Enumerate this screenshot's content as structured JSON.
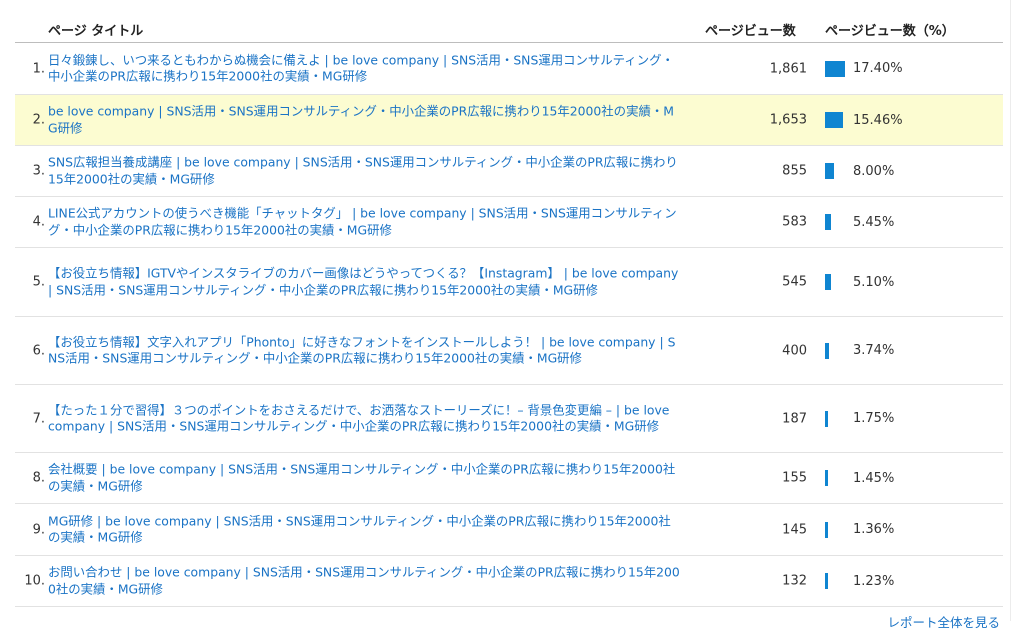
{
  "header": {
    "page_title": "ページ タイトル",
    "pageviews": "ページビュー数",
    "pageviews_pct": "ページビュー数（%）"
  },
  "accent_color": "#0f85d1",
  "highlight_color": "#fcfcd1",
  "rows": [
    {
      "rank": "1.",
      "title": "日々鍛錬し、いつ来るともわからぬ機会に備えよ | be love company | SNS活用・SNS運用コンサルティング・中小企業のPR広報に携わり15年2000社の実績・MG研修",
      "views": "1,861",
      "pct": "17.40%",
      "pct_value": 17.4
    },
    {
      "rank": "2.",
      "title": "be love company | SNS活用・SNS運用コンサルティング・中小企業のPR広報に携わり15年2000社の実績・MG研修",
      "views": "1,653",
      "pct": "15.46%",
      "pct_value": 15.46
    },
    {
      "rank": "3.",
      "title": "SNS広報担当養成講座 | be love company | SNS活用・SNS運用コンサルティング・中小企業のPR広報に携わり15年2000社の実績・MG研修",
      "views": "855",
      "pct": "8.00%",
      "pct_value": 8.0
    },
    {
      "rank": "4.",
      "title": "LINE公式アカウントの使うべき機能「チャットタグ」 | be love company | SNS活用・SNS運用コンサルティング・中小企業のPR広報に携わり15年2000社の実績・MG研修",
      "views": "583",
      "pct": "5.45%",
      "pct_value": 5.45
    },
    {
      "rank": "5.",
      "title": "【お役立ち情報】IGTVやインスタライブのカバー画像はどうやってつくる？【Instagram】 | be love company | SNS活用・SNS運用コンサルティング・中小企業のPR広報に携わり15年2000社の実績・MG研修",
      "views": "545",
      "pct": "5.10%",
      "pct_value": 5.1
    },
    {
      "rank": "6.",
      "title": "【お役立ち情報】文字入れアプリ「Phonto」に好きなフォントをインストールしよう！ | be love company | SNS活用・SNS運用コンサルティング・中小企業のPR広報に携わり15年2000社の実績・MG研修",
      "views": "400",
      "pct": "3.74%",
      "pct_value": 3.74
    },
    {
      "rank": "7.",
      "title": "【たった１分で習得】３つのポイントをおさえるだけで、お洒落なストーリーズに！– 背景色変更編 – | be love company | SNS活用・SNS運用コンサルティング・中小企業のPR広報に携わり15年2000社の実績・MG研修",
      "views": "187",
      "pct": "1.75%",
      "pct_value": 1.75
    },
    {
      "rank": "8.",
      "title": "会社概要 | be love company | SNS活用・SNS運用コンサルティング・中小企業のPR広報に携わり15年2000社の実績・MG研修",
      "views": "155",
      "pct": "1.45%",
      "pct_value": 1.45
    },
    {
      "rank": "9.",
      "title": "MG研修 | be love company | SNS活用・SNS運用コンサルティング・中小企業のPR広報に携わり15年2000社の実績・MG研修",
      "views": "145",
      "pct": "1.36%",
      "pct_value": 1.36
    },
    {
      "rank": "10.",
      "title": "お問い合わせ | be love company | SNS活用・SNS運用コンサルティング・中小企業のPR広報に携わり15年2000社の実績・MG研修",
      "views": "132",
      "pct": "1.23%",
      "pct_value": 1.23
    }
  ],
  "footer": {
    "more_link": "レポート全体を見る"
  }
}
